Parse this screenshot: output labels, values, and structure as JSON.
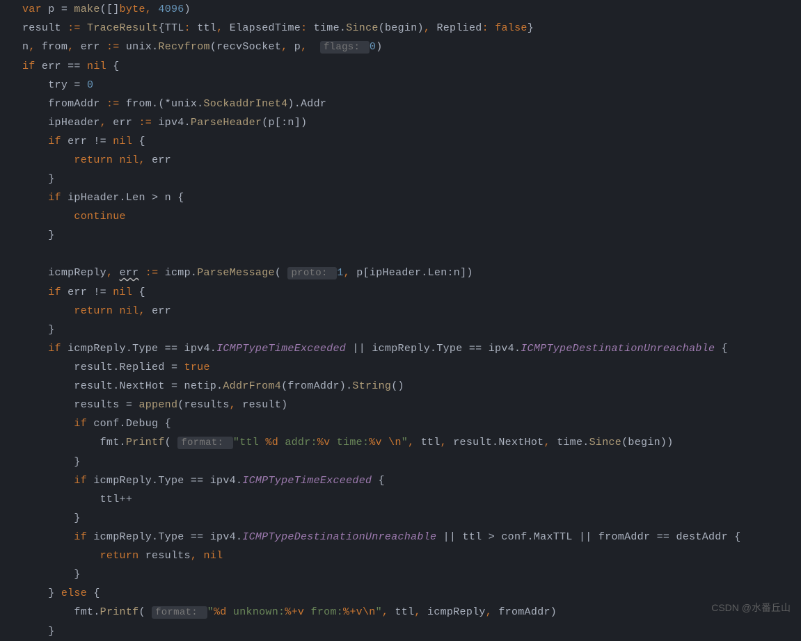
{
  "watermark": "CSDN @水番丘山",
  "code": {
    "lines": [
      {
        "indent": 0,
        "tokens": [
          [
            "kw",
            "var"
          ],
          [
            "ident",
            " p "
          ],
          [
            "punct",
            "= "
          ],
          [
            "fn",
            "make"
          ],
          [
            "punct",
            "([]"
          ],
          [
            "kw",
            "byte"
          ],
          [
            "orange",
            ","
          ],
          [
            "ident",
            " "
          ],
          [
            "num",
            "4096"
          ],
          [
            "punct",
            ")"
          ]
        ]
      },
      {
        "indent": 0,
        "tokens": [
          [
            "ident",
            "result "
          ],
          [
            "orange",
            ":= "
          ],
          [
            "type",
            "TraceResult"
          ],
          [
            "punct",
            "{TTL"
          ],
          [
            "orange",
            ":"
          ],
          [
            "ident",
            " ttl"
          ],
          [
            "orange",
            ","
          ],
          [
            "ident",
            " "
          ],
          [
            "punct",
            "ElapsedTime"
          ],
          [
            "orange",
            ":"
          ],
          [
            "ident",
            " time."
          ],
          [
            "fn",
            "Since"
          ],
          [
            "punct",
            "(begin)"
          ],
          [
            "orange",
            ","
          ],
          [
            "ident",
            " "
          ],
          [
            "punct",
            "Replied"
          ],
          [
            "orange",
            ":"
          ],
          [
            "ident",
            " "
          ],
          [
            "bool",
            "false"
          ],
          [
            "punct",
            "}"
          ]
        ]
      },
      {
        "indent": 0,
        "tokens": [
          [
            "ident",
            "n"
          ],
          [
            "orange",
            ","
          ],
          [
            "ident",
            " from"
          ],
          [
            "orange",
            ","
          ],
          [
            "ident",
            " err "
          ],
          [
            "orange",
            ":="
          ],
          [
            "ident",
            " unix."
          ],
          [
            "fn",
            "Recvfrom"
          ],
          [
            "punct",
            "(recvSocket"
          ],
          [
            "orange",
            ","
          ],
          [
            "ident",
            " p"
          ],
          [
            "orange",
            ","
          ],
          [
            "ident",
            "  "
          ],
          [
            "hint",
            "flags: "
          ],
          [
            "num",
            "0"
          ],
          [
            "punct",
            ")"
          ]
        ]
      },
      {
        "indent": 0,
        "tokens": [
          [
            "kw",
            "if"
          ],
          [
            "ident",
            " err == "
          ],
          [
            "kw",
            "nil"
          ],
          [
            "punct",
            " {"
          ]
        ]
      },
      {
        "indent": 1,
        "tokens": [
          [
            "ident",
            "try = "
          ],
          [
            "num",
            "0"
          ]
        ]
      },
      {
        "indent": 1,
        "tokens": [
          [
            "ident",
            "fromAddr "
          ],
          [
            "orange",
            ":="
          ],
          [
            "ident",
            " from.(*unix."
          ],
          [
            "type",
            "SockaddrInet4"
          ],
          [
            "punct",
            ").Addr"
          ]
        ]
      },
      {
        "indent": 1,
        "tokens": [
          [
            "ident",
            "ipHeader"
          ],
          [
            "orange",
            ","
          ],
          [
            "ident",
            " err "
          ],
          [
            "orange",
            ":="
          ],
          [
            "ident",
            " ipv4."
          ],
          [
            "fn",
            "ParseHeader"
          ],
          [
            "punct",
            "(p[:n])"
          ]
        ]
      },
      {
        "indent": 1,
        "tokens": [
          [
            "kw",
            "if"
          ],
          [
            "ident",
            " err != "
          ],
          [
            "kw",
            "nil"
          ],
          [
            "punct",
            " {"
          ]
        ]
      },
      {
        "indent": 2,
        "tokens": [
          [
            "kw",
            "return"
          ],
          [
            "ident",
            " "
          ],
          [
            "kw",
            "nil"
          ],
          [
            "orange",
            ","
          ],
          [
            "ident",
            " err"
          ]
        ]
      },
      {
        "indent": 1,
        "tokens": [
          [
            "punct",
            "}"
          ]
        ]
      },
      {
        "indent": 1,
        "tokens": [
          [
            "kw",
            "if"
          ],
          [
            "ident",
            " ipHeader.Len > n {"
          ]
        ]
      },
      {
        "indent": 2,
        "tokens": [
          [
            "kw",
            "continue"
          ]
        ]
      },
      {
        "indent": 1,
        "tokens": [
          [
            "punct",
            "}"
          ]
        ]
      },
      {
        "indent": 1,
        "tokens": [
          [
            "ident",
            ""
          ]
        ]
      },
      {
        "indent": 1,
        "tokens": [
          [
            "ident",
            "icmpReply"
          ],
          [
            "orange",
            ","
          ],
          [
            "ident",
            " "
          ],
          [
            "errund",
            "err"
          ],
          [
            "ident",
            " "
          ],
          [
            "orange",
            ":="
          ],
          [
            "ident",
            " icmp."
          ],
          [
            "fn",
            "ParseMessage"
          ],
          [
            "punct",
            "( "
          ],
          [
            "hint",
            "proto: "
          ],
          [
            "num",
            "1"
          ],
          [
            "orange",
            ","
          ],
          [
            "ident",
            " p[ipHeader.Len:n])"
          ]
        ]
      },
      {
        "indent": 1,
        "tokens": [
          [
            "kw",
            "if"
          ],
          [
            "ident",
            " err != "
          ],
          [
            "kw",
            "nil"
          ],
          [
            "punct",
            " {"
          ]
        ]
      },
      {
        "indent": 2,
        "tokens": [
          [
            "kw",
            "return"
          ],
          [
            "ident",
            " "
          ],
          [
            "kw",
            "nil"
          ],
          [
            "orange",
            ","
          ],
          [
            "ident",
            " err"
          ]
        ]
      },
      {
        "indent": 1,
        "tokens": [
          [
            "punct",
            "}"
          ]
        ]
      },
      {
        "indent": 1,
        "tokens": [
          [
            "kw",
            "if"
          ],
          [
            "ident",
            " icmpReply.Type == ipv4."
          ],
          [
            "italic",
            "ICMPTypeTimeExceeded"
          ],
          [
            "ident",
            " || icmpReply.Type == ipv4."
          ],
          [
            "italic",
            "ICMPTypeDestinationUnreachable"
          ],
          [
            "punct",
            " {"
          ]
        ]
      },
      {
        "indent": 2,
        "tokens": [
          [
            "ident",
            "result.Replied = "
          ],
          [
            "bool",
            "true"
          ]
        ]
      },
      {
        "indent": 2,
        "tokens": [
          [
            "ident",
            "result.NextHot = netip."
          ],
          [
            "fn",
            "AddrFrom4"
          ],
          [
            "punct",
            "(fromAddr)."
          ],
          [
            "fn",
            "String"
          ],
          [
            "punct",
            "()"
          ]
        ]
      },
      {
        "indent": 2,
        "tokens": [
          [
            "ident",
            "results = "
          ],
          [
            "fn",
            "append"
          ],
          [
            "punct",
            "(results"
          ],
          [
            "orange",
            ","
          ],
          [
            "ident",
            " result)"
          ]
        ]
      },
      {
        "indent": 2,
        "tokens": [
          [
            "kw",
            "if"
          ],
          [
            "ident",
            " conf.Debug {"
          ]
        ]
      },
      {
        "indent": 3,
        "tokens": [
          [
            "ident",
            "fmt."
          ],
          [
            "fn",
            "Printf"
          ],
          [
            "punct",
            "( "
          ],
          [
            "hint",
            "format: "
          ],
          [
            "str",
            "\"ttl "
          ],
          [
            "orange",
            "%d"
          ],
          [
            "str",
            " addr:"
          ],
          [
            "orange",
            "%v"
          ],
          [
            "str",
            " time:"
          ],
          [
            "orange",
            "%v"
          ],
          [
            "str",
            " "
          ],
          [
            "orange",
            "\\n"
          ],
          [
            "str",
            "\""
          ],
          [
            "orange",
            ","
          ],
          [
            "ident",
            " ttl"
          ],
          [
            "orange",
            ","
          ],
          [
            "ident",
            " result.NextHot"
          ],
          [
            "orange",
            ","
          ],
          [
            "ident",
            " time."
          ],
          [
            "fn",
            "Since"
          ],
          [
            "punct",
            "(begin))"
          ]
        ]
      },
      {
        "indent": 2,
        "tokens": [
          [
            "punct",
            "}"
          ]
        ]
      },
      {
        "indent": 2,
        "tokens": [
          [
            "kw",
            "if"
          ],
          [
            "ident",
            " icmpReply.Type == ipv4."
          ],
          [
            "italic",
            "ICMPTypeTimeExceeded"
          ],
          [
            "punct",
            " {"
          ]
        ]
      },
      {
        "indent": 3,
        "tokens": [
          [
            "ident",
            "ttl++"
          ]
        ]
      },
      {
        "indent": 2,
        "tokens": [
          [
            "punct",
            "}"
          ]
        ]
      },
      {
        "indent": 2,
        "tokens": [
          [
            "kw",
            "if"
          ],
          [
            "ident",
            " icmpReply.Type == ipv4."
          ],
          [
            "italic",
            "ICMPTypeDestinationUnreachable"
          ],
          [
            "ident",
            " || ttl > conf.MaxTTL || fromAddr == destAddr {"
          ]
        ]
      },
      {
        "indent": 3,
        "tokens": [
          [
            "kw",
            "return"
          ],
          [
            "ident",
            " results"
          ],
          [
            "orange",
            ","
          ],
          [
            "ident",
            " "
          ],
          [
            "kw",
            "nil"
          ]
        ]
      },
      {
        "indent": 2,
        "tokens": [
          [
            "punct",
            "}"
          ]
        ]
      },
      {
        "indent": 1,
        "tokens": [
          [
            "punct",
            "} "
          ],
          [
            "kw",
            "else"
          ],
          [
            "punct",
            " {"
          ]
        ]
      },
      {
        "indent": 2,
        "tokens": [
          [
            "ident",
            "fmt."
          ],
          [
            "fn",
            "Printf"
          ],
          [
            "punct",
            "( "
          ],
          [
            "hint",
            "format: "
          ],
          [
            "str",
            "\""
          ],
          [
            "orange",
            "%d"
          ],
          [
            "str",
            " unknown:"
          ],
          [
            "orange",
            "%+v"
          ],
          [
            "str",
            " from:"
          ],
          [
            "orange",
            "%+v\\n"
          ],
          [
            "str",
            "\""
          ],
          [
            "orange",
            ","
          ],
          [
            "ident",
            " ttl"
          ],
          [
            "orange",
            ","
          ],
          [
            "ident",
            " icmpReply"
          ],
          [
            "orange",
            ","
          ],
          [
            "ident",
            " fromAddr)"
          ]
        ]
      },
      {
        "indent": 1,
        "tokens": [
          [
            "punct",
            "}"
          ]
        ]
      }
    ]
  }
}
